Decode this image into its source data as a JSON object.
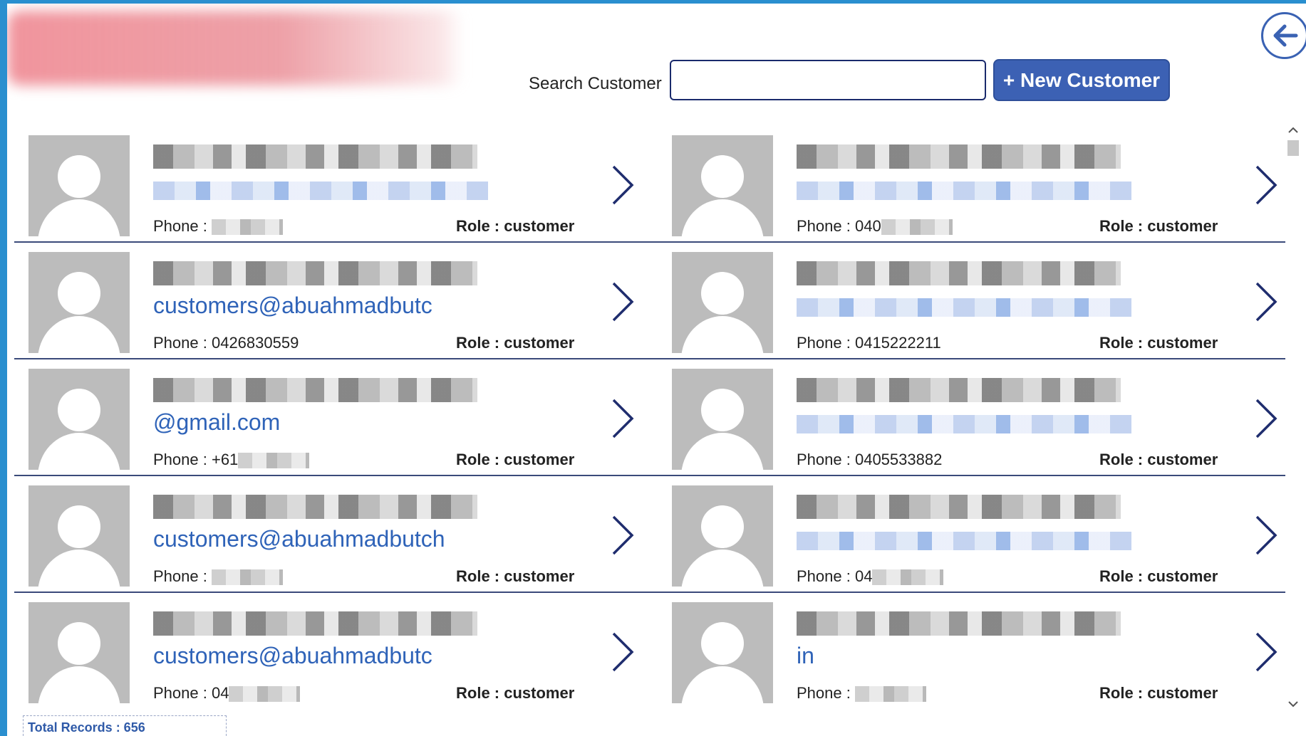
{
  "app": {
    "logo": "Abu Ahmad Butchery logo"
  },
  "header": {
    "back_icon": "arrow-left-icon",
    "search_label": "Search Customer",
    "search_value": "",
    "search_placeholder": "",
    "new_customer_label": "+ New Customer"
  },
  "customers": [
    {
      "email": "",
      "phone_label": "Phone :",
      "phone_visible": "",
      "role_label": "Role :",
      "role_value": "customer"
    },
    {
      "email": "",
      "phone_label": "Phone :",
      "phone_visible": "040",
      "role_label": "Role :",
      "role_value": "customer"
    },
    {
      "email": "customers@abuahmadbutc",
      "phone_label": "Phone :",
      "phone_visible": "0426830559",
      "role_label": "Role :",
      "role_value": "customer"
    },
    {
      "email": "",
      "phone_label": "Phone :",
      "phone_visible": "0415222211",
      "role_label": "Role :",
      "role_value": "customer"
    },
    {
      "email": "@gmail.com",
      "phone_label": "Phone :",
      "phone_visible": "+61",
      "role_label": "Role :",
      "role_value": "customer"
    },
    {
      "email": "",
      "phone_label": "Phone :",
      "phone_visible": "0405533882",
      "role_label": "Role :",
      "role_value": "customer"
    },
    {
      "email": "customers@abuahmadbutch",
      "phone_label": "Phone :",
      "phone_visible": "",
      "role_label": "Role :",
      "role_value": "customer"
    },
    {
      "email": "",
      "phone_label": "Phone :",
      "phone_visible": "04",
      "role_label": "Role :",
      "role_value": "customer"
    },
    {
      "email": "customers@abuahmadbutc",
      "phone_label": "Phone :",
      "phone_visible": "04",
      "role_label": "Role :",
      "role_value": "customer"
    },
    {
      "email": "in",
      "phone_label": "Phone :",
      "phone_visible": "",
      "role_label": "Role :",
      "role_value": "customer"
    }
  ],
  "footer": {
    "total_records": "Total Records : 656"
  },
  "colors": {
    "accent": "#3c61b4",
    "link": "#2f63b8",
    "background": "#2a8fcf"
  }
}
